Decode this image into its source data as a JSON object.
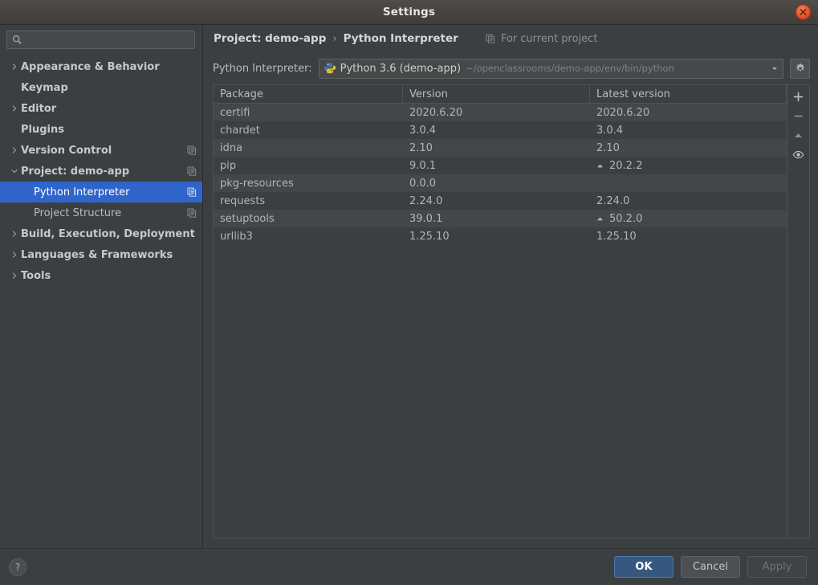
{
  "window": {
    "title": "Settings",
    "close_icon": "close-icon"
  },
  "sidebar": {
    "search": {
      "placeholder": "",
      "value": "",
      "icon": "search-icon"
    },
    "items": [
      {
        "label": "Appearance & Behavior",
        "level": 0,
        "arrow": "chevron-right-icon",
        "copy": false,
        "selected": false
      },
      {
        "label": "Keymap",
        "level": 0,
        "arrow": "",
        "copy": false,
        "selected": false
      },
      {
        "label": "Editor",
        "level": 0,
        "arrow": "chevron-right-icon",
        "copy": false,
        "selected": false
      },
      {
        "label": "Plugins",
        "level": 0,
        "arrow": "",
        "copy": false,
        "selected": false
      },
      {
        "label": "Version Control",
        "level": 0,
        "arrow": "chevron-right-icon",
        "copy": true,
        "selected": false
      },
      {
        "label": "Project: demo-app",
        "level": 0,
        "arrow": "chevron-down-icon",
        "copy": true,
        "selected": false
      },
      {
        "label": "Python Interpreter",
        "level": 1,
        "arrow": "",
        "copy": true,
        "selected": true
      },
      {
        "label": "Project Structure",
        "level": 1,
        "arrow": "",
        "copy": true,
        "selected": false
      },
      {
        "label": "Build, Execution, Deployment",
        "level": 0,
        "arrow": "chevron-right-icon",
        "copy": false,
        "selected": false
      },
      {
        "label": "Languages & Frameworks",
        "level": 0,
        "arrow": "chevron-right-icon",
        "copy": false,
        "selected": false
      },
      {
        "label": "Tools",
        "level": 0,
        "arrow": "chevron-right-icon",
        "copy": false,
        "selected": false
      }
    ]
  },
  "main": {
    "breadcrumb": {
      "root": "Project: demo-app",
      "separator": "›",
      "current": "Python Interpreter"
    },
    "scope_hint": {
      "icon": "copy-module-icon",
      "label": "For current project"
    },
    "interpreter": {
      "label": "Python Interpreter:",
      "icon": "python-venv-icon",
      "name": "Python 3.6 (demo-app)",
      "path": "~/openclassrooms/demo-app/env/bin/python",
      "dropdown_icon": "chevron-down-icon",
      "settings_icon": "gear-icon"
    },
    "packages": {
      "columns": [
        "Package",
        "Version",
        "Latest version"
      ],
      "rows": [
        {
          "package": "certifi",
          "version": "2020.6.20",
          "latest": "2020.6.20",
          "upgrade": false
        },
        {
          "package": "chardet",
          "version": "3.0.4",
          "latest": "3.0.4",
          "upgrade": false
        },
        {
          "package": "idna",
          "version": "2.10",
          "latest": "2.10",
          "upgrade": false
        },
        {
          "package": "pip",
          "version": "9.0.1",
          "latest": "20.2.2",
          "upgrade": true
        },
        {
          "package": "pkg-resources",
          "version": "0.0.0",
          "latest": "",
          "upgrade": false
        },
        {
          "package": "requests",
          "version": "2.24.0",
          "latest": "2.24.0",
          "upgrade": false
        },
        {
          "package": "setuptools",
          "version": "39.0.1",
          "latest": "50.2.0",
          "upgrade": true
        },
        {
          "package": "urllib3",
          "version": "1.25.10",
          "latest": "1.25.10",
          "upgrade": false
        }
      ],
      "tools": [
        {
          "name": "add-package-button",
          "icon": "plus-icon"
        },
        {
          "name": "remove-package-button",
          "icon": "minus-icon"
        },
        {
          "name": "upgrade-package-button",
          "icon": "triangle-up-icon"
        },
        {
          "name": "show-early-releases-button",
          "icon": "eye-icon"
        }
      ]
    }
  },
  "footer": {
    "help_label": "?",
    "ok_label": "OK",
    "cancel_label": "Cancel",
    "apply_label": "Apply"
  },
  "colors": {
    "background": "#3c3f41",
    "selection": "#2f65ca",
    "primary_button": "#365880",
    "row_alt": "#434749",
    "close_button": "#e8542a"
  }
}
